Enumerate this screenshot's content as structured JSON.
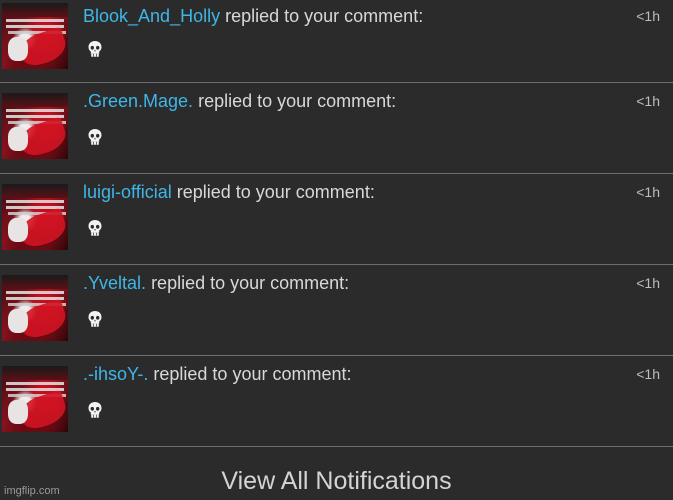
{
  "notifications": [
    {
      "user": "Blook_And_Holly",
      "action": "replied to your comment:",
      "time": "<1h",
      "body_icon": "skull-icon"
    },
    {
      "user": ".Green.Mage.",
      "action": "replied to your comment:",
      "time": "<1h",
      "body_icon": "skull-icon"
    },
    {
      "user": "luigi-official",
      "action": "replied to your comment:",
      "time": "<1h",
      "body_icon": "skull-icon"
    },
    {
      "user": ".Yveltal.",
      "action": "replied to your comment:",
      "time": "<1h",
      "body_icon": "skull-icon"
    },
    {
      "user": ".-ihsoY-.",
      "action": "replied to your comment:",
      "time": "<1h",
      "body_icon": "skull-icon"
    }
  ],
  "footer": {
    "view_all_label": "View All Notifications"
  },
  "watermark": "imgflip.com",
  "colors": {
    "background": "#2b2b2b",
    "username": "#3fb6e8",
    "text": "#d8d8d8",
    "divider": "#6e6e6e"
  }
}
